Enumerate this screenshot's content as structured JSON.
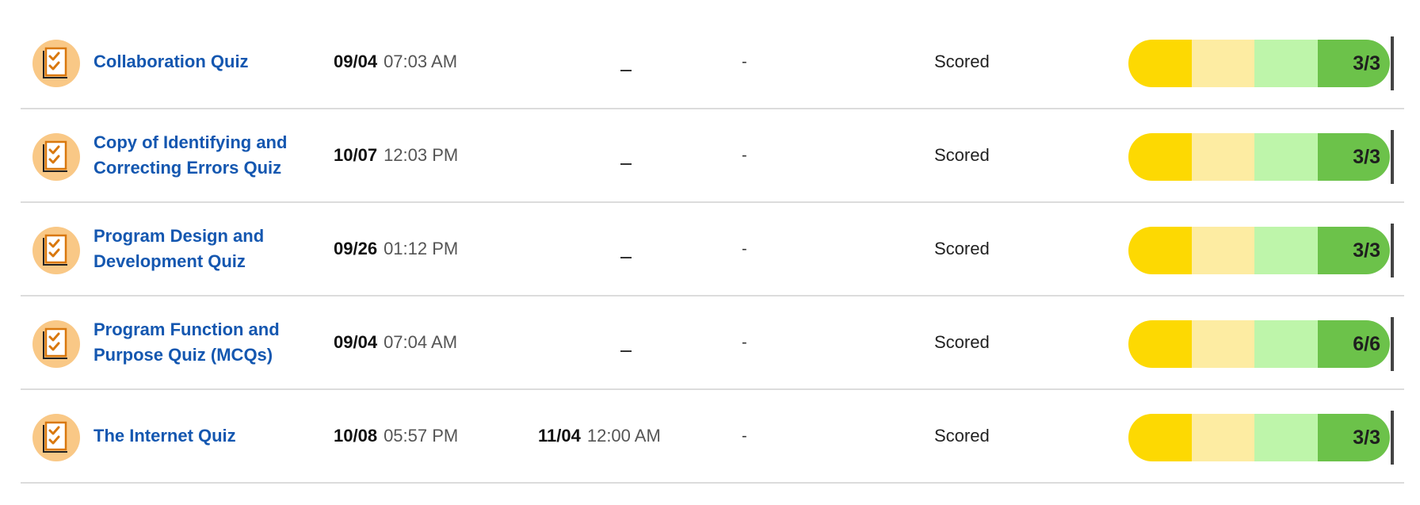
{
  "colors": {
    "title_link": "#1457b0",
    "icon_bg": "#f9c886",
    "icon_accent": "#d9780e",
    "score_segments": [
      "#fdd902",
      "#fdeca2",
      "#bef5aa",
      "#6cc24a"
    ],
    "divider": "#dcdcdc"
  },
  "rows": [
    {
      "icon": "quiz-checklist-icon",
      "title": "Collaboration Quiz",
      "start_date": "09/04",
      "start_time": "07:03 AM",
      "due_date": "",
      "due_time": "",
      "due_placeholder": "_",
      "extra": "-",
      "status": "Scored",
      "score": "3/3"
    },
    {
      "icon": "quiz-checklist-icon",
      "title": "Copy of Identifying and Correcting Errors Quiz",
      "start_date": "10/07",
      "start_time": "12:03 PM",
      "due_date": "",
      "due_time": "",
      "due_placeholder": "_",
      "extra": "-",
      "status": "Scored",
      "score": "3/3"
    },
    {
      "icon": "quiz-checklist-icon",
      "title": "Program Design and Development Quiz",
      "start_date": "09/26",
      "start_time": "01:12 PM",
      "due_date": "",
      "due_time": "",
      "due_placeholder": "_",
      "extra": "-",
      "status": "Scored",
      "score": "3/3"
    },
    {
      "icon": "quiz-checklist-icon",
      "title": "Program Function and Purpose Quiz (MCQs)",
      "start_date": "09/04",
      "start_time": "07:04 AM",
      "due_date": "",
      "due_time": "",
      "due_placeholder": "_",
      "extra": "-",
      "status": "Scored",
      "score": "6/6"
    },
    {
      "icon": "quiz-checklist-icon",
      "title": "The Internet Quiz",
      "start_date": "10/08",
      "start_time": "05:57 PM",
      "due_date": "11/04",
      "due_time": "12:00 AM",
      "due_placeholder": "",
      "extra": "-",
      "status": "Scored",
      "score": "3/3"
    }
  ]
}
